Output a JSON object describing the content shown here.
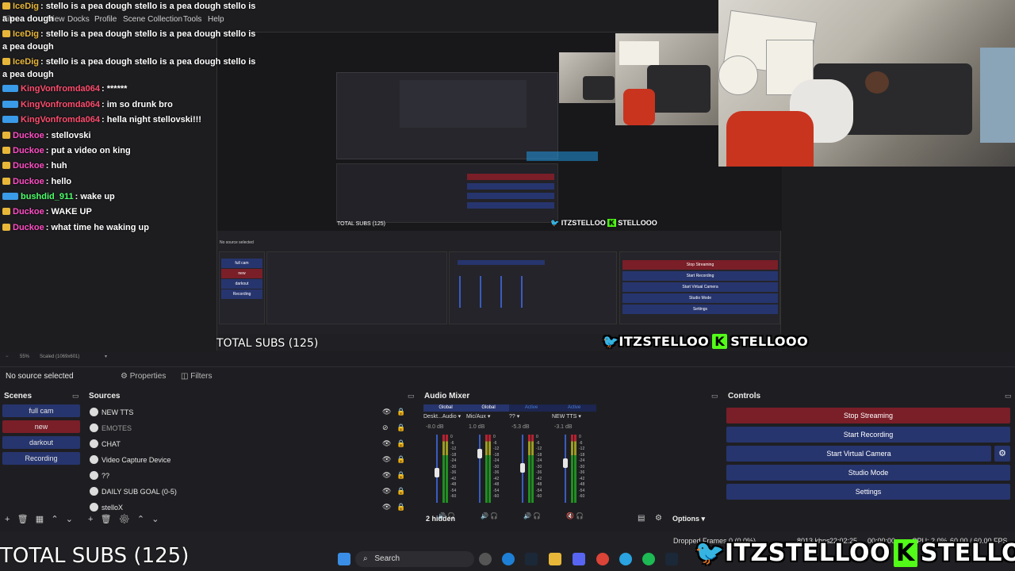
{
  "menu": {
    "file": "File",
    "view": "View",
    "docks": "Docks",
    "profile": "Profile",
    "scene_collection": "Scene Collection",
    "tools": "Tools",
    "help": "Help"
  },
  "chat": [
    {
      "badge": "sub",
      "user": "IceDig",
      "user_color": "#e8b73a",
      "msg": ": stello is a pea dough stello is a pea dough stello is"
    },
    {
      "badge": "",
      "user": "",
      "user_color": "#ffffff",
      "msg": "a pea dough"
    },
    {
      "badge": "sub",
      "user": "IceDig",
      "user_color": "#e8b73a",
      "msg": ": stello is a pea dough stello is a pea dough stello is"
    },
    {
      "badge": "",
      "user": "",
      "user_color": "#ffffff",
      "msg": "a pea dough"
    },
    {
      "badge": "sub",
      "user": "IceDig",
      "user_color": "#e8b73a",
      "msg": ": stello is a pea dough stello is a pea dough stello is"
    },
    {
      "badge": "",
      "user": "",
      "user_color": "#ffffff",
      "msg": "a pea dough"
    },
    {
      "badge": "prime",
      "user": "KingVonfromda064",
      "user_color": "#ff4d6d",
      "msg": ": ******"
    },
    {
      "badge": "prime",
      "user": "KingVonfromda064",
      "user_color": "#ff4d6d",
      "msg": ": im so drunk bro"
    },
    {
      "badge": "prime",
      "user": "KingVonfromda064",
      "user_color": "#ff4d6d",
      "msg": ": hella night stellovski!!!"
    },
    {
      "badge": "sub",
      "user": "Duckoe",
      "user_color": "#ff4dc4",
      "msg": ": stellovski"
    },
    {
      "badge": "sub",
      "user": "Duckoe",
      "user_color": "#ff4dc4",
      "msg": ": put a video on king"
    },
    {
      "badge": "sub",
      "user": "Duckoe",
      "user_color": "#ff4dc4",
      "msg": ": huh"
    },
    {
      "badge": "sub",
      "user": "Duckoe",
      "user_color": "#ff4dc4",
      "msg": ": hello"
    },
    {
      "badge": "prime",
      "user": "bushdid_911",
      "user_color": "#4dff6a",
      "msg": ": wake up"
    },
    {
      "badge": "sub",
      "user": "Duckoe",
      "user_color": "#ff4dc4",
      "msg": ": WAKE UP"
    },
    {
      "badge": "sub",
      "user": "Duckoe",
      "user_color": "#ff4dc4",
      "msg": ": what time he waking up"
    }
  ],
  "overlay": {
    "total_subs": "TOTAL SUBS (125)",
    "brand_twitter": "ITZSTELLOO",
    "brand_kick_letter": "K",
    "brand_kick": "STELLOOO"
  },
  "zoom": {
    "percent": "55%",
    "mode": "Scaled (1069x601)"
  },
  "source_bar": {
    "no_source": "No source selected",
    "properties": "Properties",
    "filters": "Filters"
  },
  "scenes": {
    "title": "Scenes",
    "items": [
      {
        "label": "full cam",
        "active": false
      },
      {
        "label": "new",
        "active": true
      },
      {
        "label": "darkout",
        "active": false
      },
      {
        "label": "Recording",
        "active": false
      }
    ]
  },
  "sources": {
    "title": "Sources",
    "items": [
      {
        "label": "NEW TTS",
        "icon": "browser-icon",
        "visible": true
      },
      {
        "label": "EMOTES",
        "icon": "browser-icon",
        "visible": false
      },
      {
        "label": "CHAT",
        "icon": "browser-icon",
        "visible": true
      },
      {
        "label": "Video Capture Device",
        "icon": "camera-icon",
        "visible": true
      },
      {
        "label": "??",
        "icon": "browser-icon",
        "visible": true
      },
      {
        "label": "DAILY SUB GOAL (0-5)",
        "icon": "group-icon",
        "visible": true
      },
      {
        "label": "stelloX",
        "icon": "image-icon",
        "visible": true
      }
    ]
  },
  "mixer": {
    "title": "Audio Mixer",
    "channels": [
      {
        "tag": "Global",
        "name": "Deskt...Audio",
        "db": "-8.0 dB",
        "level": 0.48,
        "muted": false
      },
      {
        "tag": "Global",
        "name": "Mic/Aux",
        "db": "1.0 dB",
        "level": 0.78,
        "muted": false
      },
      {
        "tag": "Active",
        "name": "??",
        "db": "-5.3 dB",
        "level": 0.55,
        "muted": false
      },
      {
        "tag": "Active",
        "name": "NEW TTS",
        "db": "-3.1 dB",
        "level": 0.62,
        "muted": true
      }
    ],
    "scale": [
      "0",
      "-6",
      "-12",
      "-18",
      "-24",
      "-30",
      "-36",
      "-42",
      "-48",
      "-54",
      "-60"
    ],
    "hidden": "2 hidden",
    "options": "Options"
  },
  "controls": {
    "title": "Controls",
    "stop_streaming": "Stop Streaming",
    "start_recording": "Start Recording",
    "start_virtual_camera": "Start Virtual Camera",
    "studio_mode": "Studio Mode",
    "settings": "Settings"
  },
  "status": {
    "dropped": "Dropped Frames 0 (0.0%)",
    "kbps": "8013 kbps",
    "time1": "22:02:25",
    "time2": "00:00:00",
    "cpu": "CPU: 2.0%",
    "fps": "60.00 / 60.00 FPS"
  },
  "taskbar": {
    "search": "Search"
  },
  "colors": {
    "stop": "#7a1e28",
    "button": "#27356e",
    "accent": "#3a5bbf"
  }
}
